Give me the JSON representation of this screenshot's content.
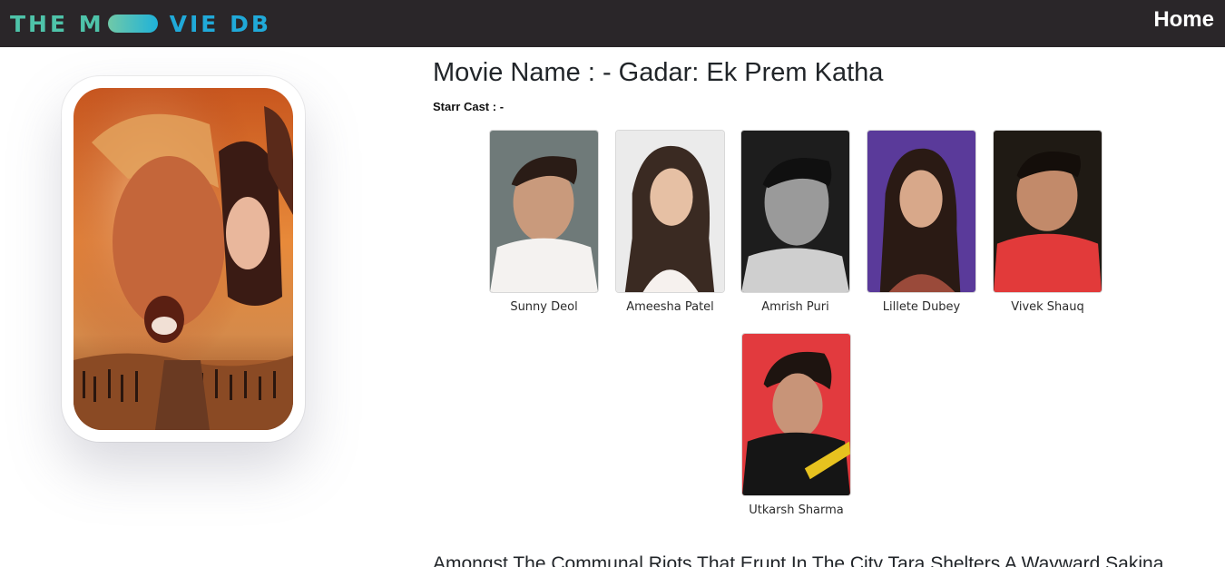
{
  "navbar": {
    "brand_part1": "THE M",
    "brand_part2": "VIE DB",
    "home_label": "Home",
    "colors": {
      "background": "#2a2629",
      "brand_green": "#4ec3a9",
      "brand_blue": "#20a9d8"
    }
  },
  "movie": {
    "title": "Movie Name : - Gadar: Ek Prem Katha",
    "cast_label": "Starr Cast : -",
    "overview": "Amongst The Communal Riots That Erupt In The City Tara Shelters A Wayward Sakina"
  },
  "cast": [
    {
      "name": "Sunny Deol",
      "photo": "actor-photo"
    },
    {
      "name": "Ameesha Patel",
      "photo": "actor-photo"
    },
    {
      "name": "Amrish Puri",
      "photo": "actor-photo"
    },
    {
      "name": "Lillete Dubey",
      "photo": "actor-photo"
    },
    {
      "name": "Vivek Shauq",
      "photo": "actor-photo"
    },
    {
      "name": "Utkarsh Sharma",
      "photo": "actor-photo"
    }
  ]
}
